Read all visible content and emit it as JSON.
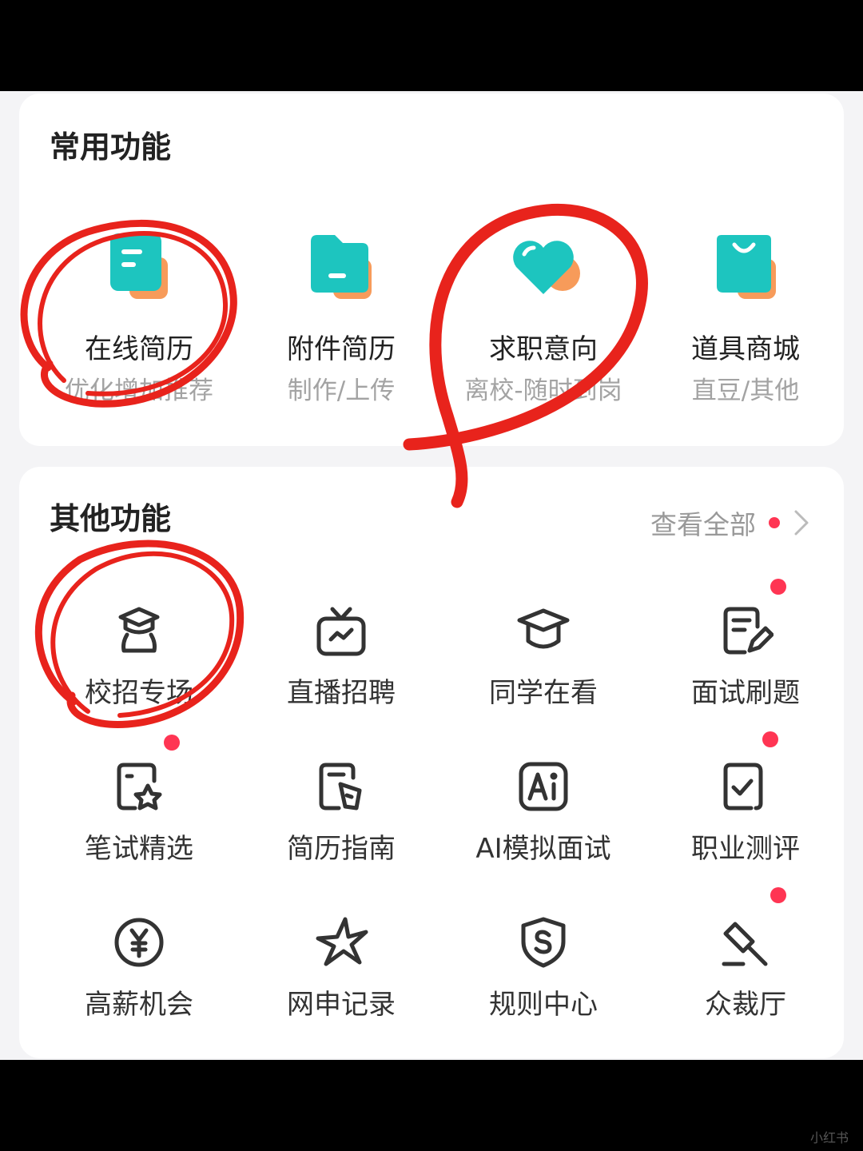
{
  "colors": {
    "accent_teal": "#1dc5bf",
    "accent_orange": "#f79b5a",
    "badge_red": "#ff3553",
    "annotation_red": "#e8231c"
  },
  "common": {
    "title": "常用功能",
    "items": [
      {
        "label": "在线简历",
        "sub": "优化增加推荐",
        "icon": "resume-doc-icon"
      },
      {
        "label": "附件简历",
        "sub": "制作/上传",
        "icon": "folder-icon"
      },
      {
        "label": "求职意向",
        "sub": "离校-随时到岗",
        "icon": "heart-icon"
      },
      {
        "label": "道具商城",
        "sub": "直豆/其他",
        "icon": "shopping-bag-icon"
      }
    ]
  },
  "other": {
    "title": "其他功能",
    "view_all": "查看全部",
    "items": [
      {
        "label": "校招专场",
        "icon": "graduate-icon",
        "badge": false
      },
      {
        "label": "直播招聘",
        "icon": "tv-icon",
        "badge": false
      },
      {
        "label": "同学在看",
        "icon": "mortarboard-icon",
        "badge": false
      },
      {
        "label": "面试刷题",
        "icon": "note-edit-icon",
        "badge": true
      },
      {
        "label": "笔试精选",
        "icon": "star-doc-icon",
        "badge": true
      },
      {
        "label": "简历指南",
        "icon": "pen-doc-icon",
        "badge": false
      },
      {
        "label": "AI模拟面试",
        "icon": "ai-icon",
        "badge": false
      },
      {
        "label": "职业测评",
        "icon": "check-doc-icon",
        "badge": true
      },
      {
        "label": "高薪机会",
        "icon": "yen-icon",
        "badge": false
      },
      {
        "label": "网申记录",
        "icon": "star-icon",
        "badge": false
      },
      {
        "label": "规则中心",
        "icon": "shield-icon",
        "badge": false
      },
      {
        "label": "众裁厅",
        "icon": "gavel-icon",
        "badge": true
      }
    ]
  },
  "watermark": "小红书"
}
